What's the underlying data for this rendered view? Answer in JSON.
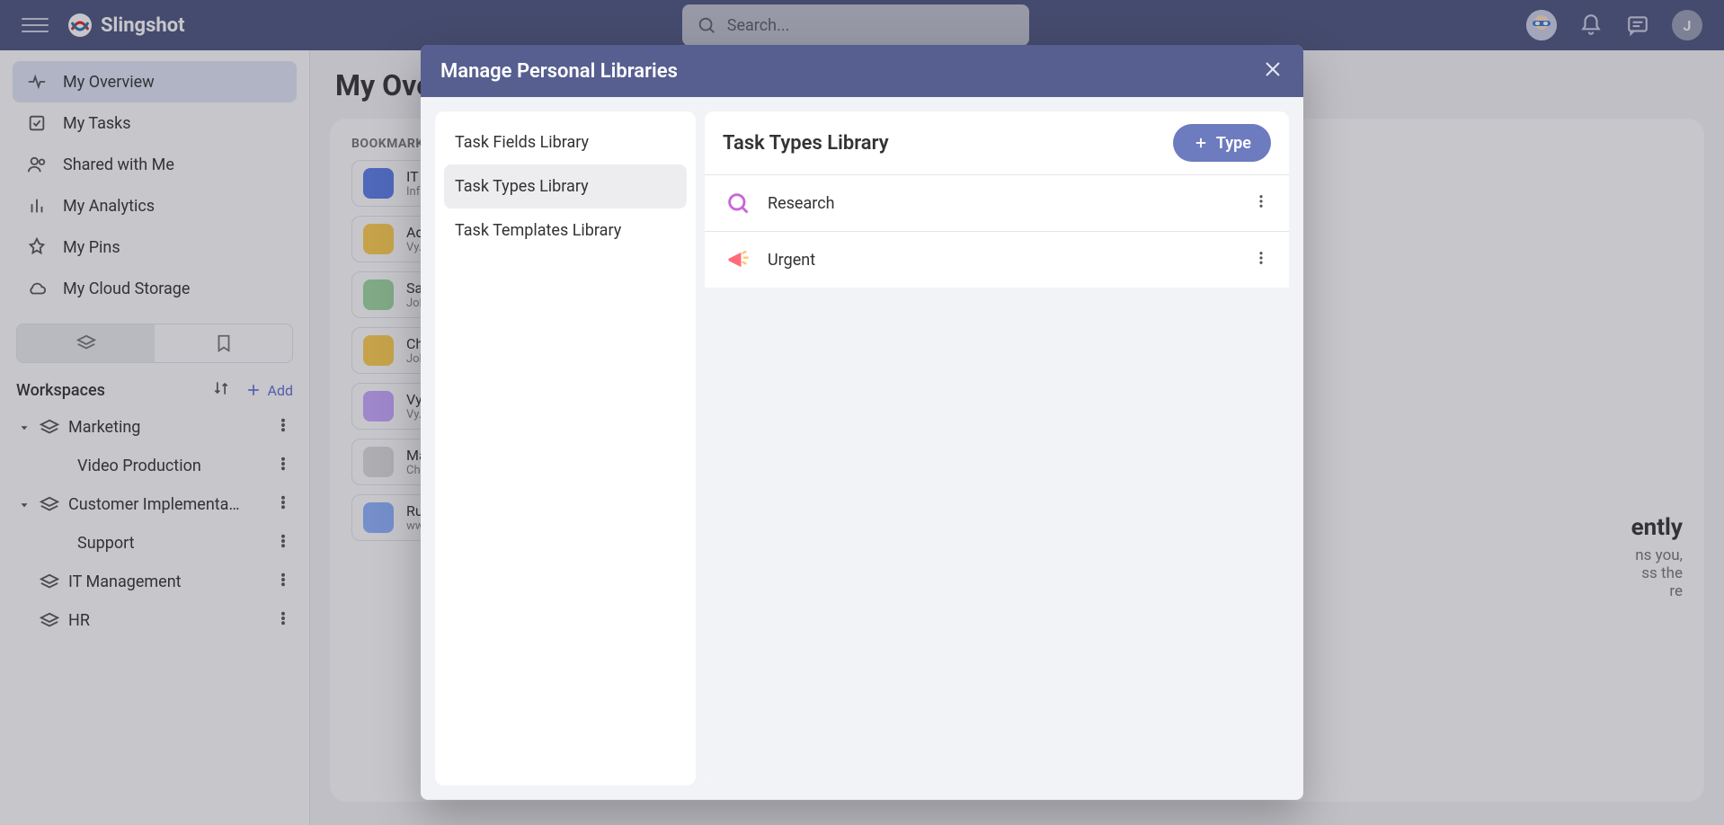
{
  "brand": {
    "name": "Slingshot"
  },
  "search": {
    "placeholder": "Search..."
  },
  "avatar_initial": "J",
  "sidebar": {
    "nav": [
      {
        "label": "My Overview",
        "icon": "activity-icon",
        "selected": true
      },
      {
        "label": "My Tasks",
        "icon": "check-square-icon",
        "selected": false
      },
      {
        "label": "Shared with Me",
        "icon": "users-icon",
        "selected": false
      },
      {
        "label": "My Analytics",
        "icon": "bar-chart-icon",
        "selected": false
      },
      {
        "label": "My Pins",
        "icon": "pin-icon",
        "selected": false
      },
      {
        "label": "My Cloud Storage",
        "icon": "cloud-icon",
        "selected": false
      }
    ],
    "workspaces_label": "Workspaces",
    "add_label": "Add",
    "workspaces": [
      {
        "label": "Marketing",
        "expanded": true,
        "children": [
          {
            "label": "Video Production"
          }
        ]
      },
      {
        "label": "Customer Implementa…",
        "expanded": true,
        "children": [
          {
            "label": "Support"
          }
        ]
      },
      {
        "label": "IT Management",
        "expanded": false,
        "children": []
      },
      {
        "label": "HR",
        "expanded": false,
        "children": []
      }
    ]
  },
  "page": {
    "title": "My Overview"
  },
  "bookmarks": {
    "section_label": "BOOKMARKS",
    "items": [
      {
        "title": "IT M…",
        "subtitle": "Infr…"
      },
      {
        "title": "Ad…",
        "subtitle": "Vy…"
      },
      {
        "title": "Sal…",
        "subtitle": "Joh…"
      },
      {
        "title": "Cha…",
        "subtitle": "Joh…"
      },
      {
        "title": "Vy…",
        "subtitle": "Vy…"
      },
      {
        "title": "Ma…",
        "subtitle": "Cha…"
      },
      {
        "title": "Run…",
        "subtitle": "ww…"
      }
    ]
  },
  "recent_tail": {
    "t1": "ently",
    "t2": "ns you,",
    "t3": "ss the",
    "t4": "re"
  },
  "modal": {
    "title": "Manage Personal Libraries",
    "nav": [
      {
        "label": "Task Fields Library",
        "active": false
      },
      {
        "label": "Task Types Library",
        "active": true
      },
      {
        "label": "Task Templates Library",
        "active": false
      }
    ],
    "panel_title": "Task Types Library",
    "add_type_label": "Type",
    "types": [
      {
        "name": "Research",
        "icon": "search"
      },
      {
        "name": "Urgent",
        "icon": "megaphone"
      }
    ]
  }
}
